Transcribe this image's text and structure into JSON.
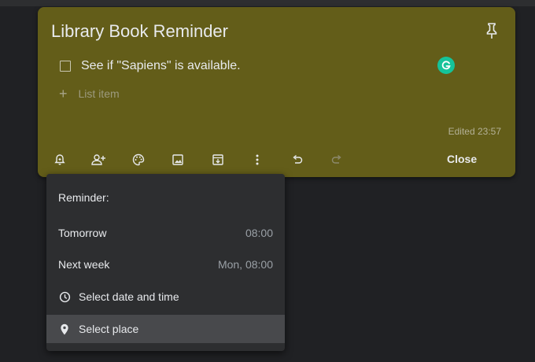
{
  "note": {
    "title": "Library Book Reminder",
    "checklist_item": "See if \"Sapiens\" is available.",
    "add_item_placeholder": "List item",
    "edited": "Edited 23:57",
    "close_label": "Close",
    "background_color": "#635d19"
  },
  "toolbar": {
    "icons": [
      "remind-me-icon",
      "collaborator-icon",
      "palette-icon",
      "image-icon",
      "archive-icon",
      "more-icon",
      "undo-icon",
      "redo-icon"
    ]
  },
  "reminder_menu": {
    "heading": "Reminder:",
    "items": [
      {
        "label": "Tomorrow",
        "time": "08:00"
      },
      {
        "label": "Next week",
        "time": "Mon, 08:00"
      },
      {
        "label": "Select date and time",
        "icon": "clock-icon"
      },
      {
        "label": "Select place",
        "icon": "place-icon",
        "highlighted": true
      }
    ]
  },
  "grammarly": {
    "letter": "G",
    "color": "#15c39a"
  }
}
